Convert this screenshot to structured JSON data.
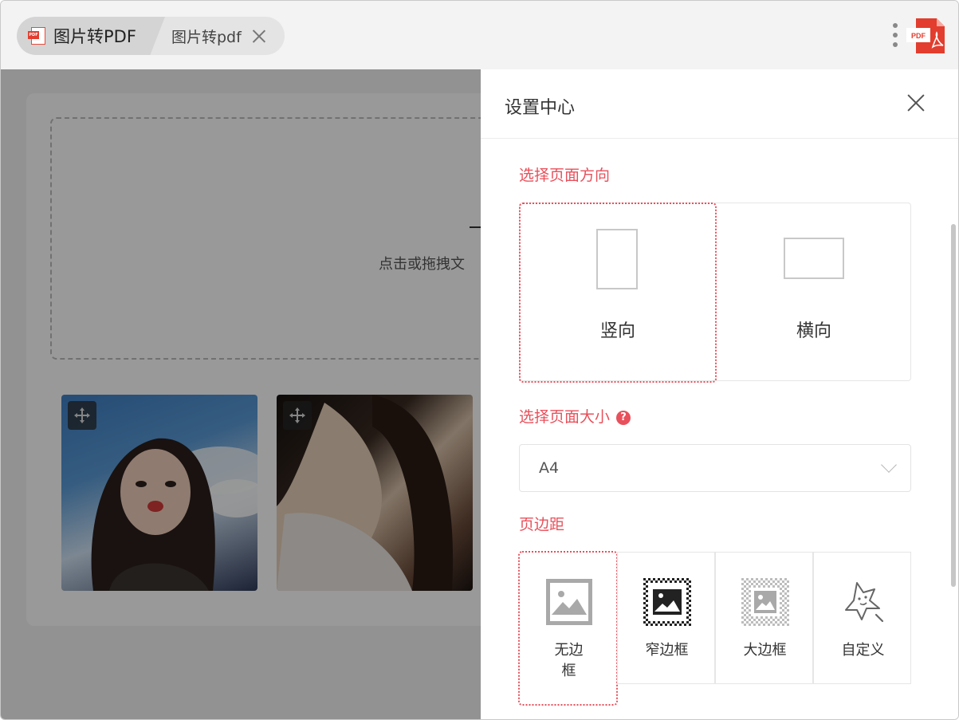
{
  "tabs": [
    {
      "label": "图片转PDF",
      "icon": "pdf-file-icon"
    },
    {
      "label": "图片转pdf",
      "icon": "close-icon"
    }
  ],
  "toolbar": {
    "more_icon": "more-vertical-icon",
    "logo_text": "PDF"
  },
  "upload": {
    "hint": "点击或拖拽文"
  },
  "settings": {
    "title": "设置中心",
    "orientation": {
      "label": "选择页面方向",
      "options": [
        {
          "label": "竖向",
          "selected": true
        },
        {
          "label": "横向",
          "selected": false
        }
      ]
    },
    "page_size": {
      "label": "选择页面大小",
      "help": "?",
      "value": "A4"
    },
    "margin": {
      "label": "页边距",
      "options": [
        {
          "label": "无边框",
          "line1": "无边",
          "line2": "框",
          "selected": true
        },
        {
          "label": "窄边框",
          "selected": false
        },
        {
          "label": "大边框",
          "selected": false
        },
        {
          "label": "自定义",
          "selected": false
        }
      ]
    }
  },
  "colors": {
    "accent": "#e8505b",
    "pdf_red": "#e23d2e"
  }
}
